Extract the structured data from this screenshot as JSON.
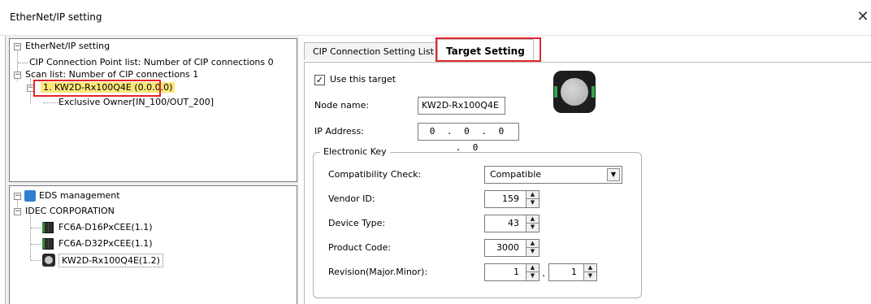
{
  "window": {
    "title": "EtherNet/IP setting",
    "close_glyph": "✕"
  },
  "tree_top": {
    "root": "EtherNet/IP setting",
    "cip_points": "CIP Connection Point list: Number of CIP connections 0",
    "scan_list": "Scan list: Number of CIP connections 1",
    "target_item": "1. KW2D-Rx100Q4E (0.0.0.0)",
    "connection": "Exclusive Owner[IN_100/OUT_200]"
  },
  "tree_bottom": {
    "root": "EDS management",
    "vendor": "IDEC CORPORATION",
    "devices": [
      "FC6A-D16PxCEE(1.1)",
      "FC6A-D32PxCEE(1.1)",
      "KW2D-Rx100Q4E(1.2)"
    ]
  },
  "tabs": {
    "list": "CIP Connection Setting List",
    "target": "Target Setting"
  },
  "target": {
    "use_label": "Use this target",
    "use_checked": true,
    "node_label": "Node name:",
    "node_value": "KW2D-Rx100Q4E",
    "ip_label": "IP Address:",
    "ip_value": "0 . 0 . 0 . 0"
  },
  "electronic_key": {
    "title": "Electronic Key",
    "compat_label": "Compatibility Check:",
    "compat_value": "Compatible",
    "vendor_label": "Vendor ID:",
    "vendor_value": "159",
    "device_label": "Device Type:",
    "device_value": "43",
    "product_label": "Product Code:",
    "product_value": "3000",
    "revision_label": "Revision(Major.Minor):",
    "revision_major": "1",
    "revision_minor": "1",
    "revision_sep": "."
  },
  "colors": {
    "highlight": "#ffe77a",
    "callout_red": "#e3262a"
  }
}
